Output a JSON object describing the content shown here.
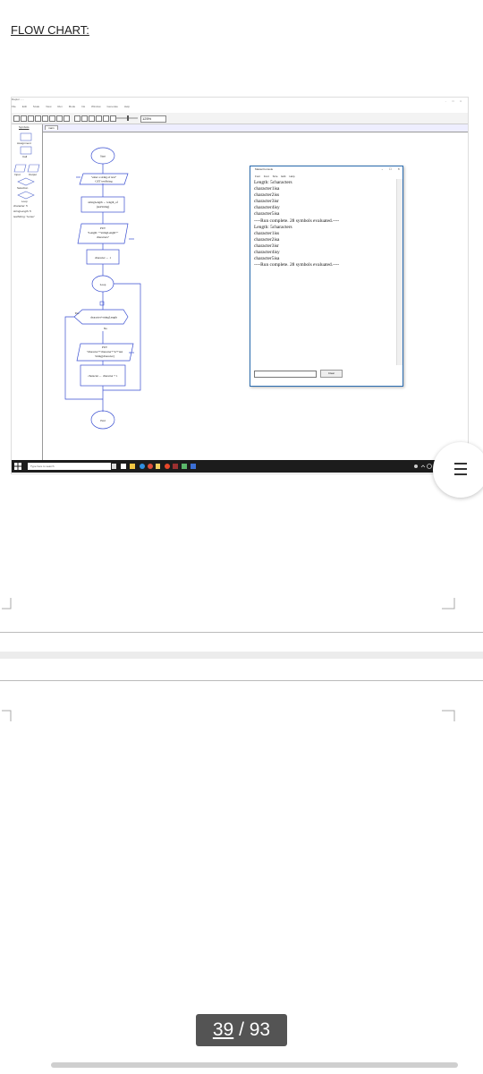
{
  "page": {
    "heading": "FLOW CHART:"
  },
  "raptor": {
    "title_text": "Raptor - ...",
    "window_controls": "-  □  ×",
    "menu": [
      "File",
      "Edit",
      "Scale",
      "View",
      "Run",
      "Mode",
      "Ink",
      "Window",
      "Generate",
      "Help"
    ],
    "zoom": "125%",
    "tab_main": "main",
    "symbols_label": "Symbols",
    "palette": {
      "assignment": "Assignment",
      "call": "Call",
      "input": "Input",
      "output": "Output",
      "selection": "Selection",
      "loop": "Loop"
    },
    "variables": [
      "character: 5",
      "stringLength: 5",
      "testString: \"tense\""
    ],
    "flowchart": {
      "start": "Start",
      "input_line1": "\"enter a string of text\"",
      "input_line2": "GET testString",
      "assign1_line1": "stringLength ← length_of",
      "assign1_line2": "(testString)",
      "output1_line1": "PUT",
      "output1_line2": "\"Length: \"+stringLength+\"",
      "output1_line3": "characters\"",
      "assign2": "character ← 1",
      "loop": "Loop",
      "decision": "character>stringLength",
      "yes": "Yes",
      "no": "No",
      "output2_line1": "PUT",
      "output2_line2": "\"character\"+character+\"is\"+test",
      "output2_line3": "String[character]",
      "assign3": "character ← character + 1",
      "end": "End"
    },
    "console": {
      "title": "MasterConsole",
      "menu": "Font  Font Size  Edit  Help",
      "lines": [
        "Length: 5characters",
        "character1isa",
        "character2iss",
        "character3isr",
        "character4isy",
        "character5isa",
        "----Run complete.  28 symbols evaluated.----",
        "Length: 5characters",
        "character1iss",
        "character2isa",
        "character3isr",
        "character4isy",
        "character5isa",
        "----Run complete.  28 symbols evaluated.----"
      ],
      "clear_button": "Clear",
      "minimize": "-",
      "maximize": "□",
      "close": "×"
    },
    "taskbar": {
      "search_placeholder": "Type here to search"
    }
  },
  "pager": {
    "current": "39",
    "separator": " / ",
    "total": "93"
  }
}
